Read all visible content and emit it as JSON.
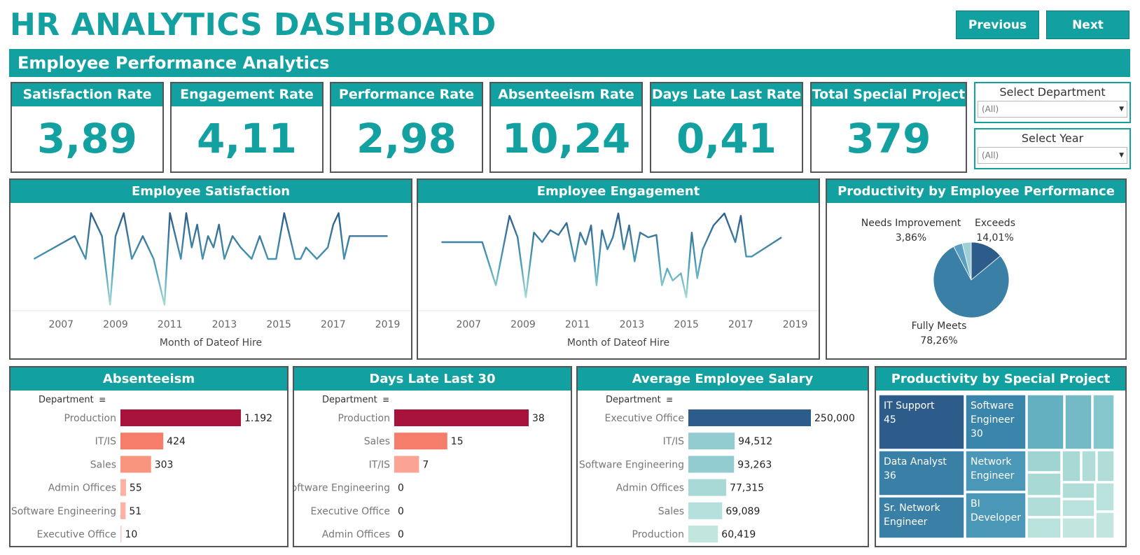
{
  "header": {
    "title": "HR ANALYTICS DASHBOARD",
    "previous_label": "Previous",
    "next_label": "Next",
    "banner": "Employee Performance Analytics"
  },
  "kpis": [
    {
      "label": "Satisfaction Rate",
      "value": "3,89"
    },
    {
      "label": "Engagement Rate",
      "value": "4,11"
    },
    {
      "label": "Performance Rate",
      "value": "2,98"
    },
    {
      "label": "Absenteeism Rate",
      "value": "10,24"
    },
    {
      "label": "Days Late Last Rate",
      "value": "0,41"
    },
    {
      "label": "Total Special Project",
      "value": "379"
    }
  ],
  "filters": [
    {
      "label": "Select Department",
      "value": "(All)"
    },
    {
      "label": "Select Year",
      "value": "(All)"
    }
  ],
  "colors": {
    "teal": "#13a0a0",
    "maroon": "#a8133b",
    "salmon": "#f67d69",
    "light_salmon": "#fbb1a4",
    "navy_blue": "#2e5c8a",
    "light_teal": "#9fd4d2"
  },
  "chart_data": [
    {
      "id": "satisfaction",
      "type": "line",
      "title": "Employee Satisfaction",
      "xlabel": "Month of Dateof Hire",
      "ylabel": "",
      "xlim": [
        2005.5,
        2019.5
      ],
      "ylim": [
        0.8,
        5.2
      ],
      "x_ticks": [
        "2007",
        "2009",
        "2011",
        "2013",
        "2015",
        "2017",
        "2019"
      ],
      "x": [
        2006.0,
        2007.5,
        2007.9,
        2008.1,
        2008.5,
        2008.8,
        2009.0,
        2009.3,
        2009.6,
        2010.0,
        2010.4,
        2010.8,
        2011.0,
        2011.2,
        2011.4,
        2011.6,
        2011.8,
        2012.0,
        2012.2,
        2012.4,
        2012.6,
        2012.8,
        2013.0,
        2013.3,
        2013.6,
        2014.0,
        2014.3,
        2014.6,
        2014.9,
        2015.2,
        2015.4,
        2015.6,
        2015.8,
        2016.0,
        2016.4,
        2016.8,
        2017.0,
        2017.2,
        2017.4,
        2017.6,
        2018.5,
        2019.0
      ],
      "y": [
        3.0,
        4.0,
        3.0,
        5.0,
        4.0,
        1.0,
        4.0,
        5.0,
        3.0,
        4.0,
        3.0,
        1.0,
        5.0,
        4.0,
        3.0,
        5.0,
        3.5,
        4.5,
        3.0,
        4.0,
        3.5,
        4.5,
        3.0,
        4.0,
        3.5,
        3.0,
        4.0,
        3.0,
        3.0,
        5.0,
        4.0,
        3.0,
        3.0,
        3.5,
        3.0,
        3.5,
        4.5,
        5.0,
        3.0,
        4.0,
        4.0,
        4.0
      ]
    },
    {
      "id": "engagement",
      "type": "line",
      "title": "Employee Engagement",
      "xlabel": "Month of Dateof Hire",
      "ylabel": "",
      "xlim": [
        2005.5,
        2019.5
      ],
      "ylim": [
        1.0,
        5.2
      ],
      "x_ticks": [
        "2007",
        "2009",
        "2011",
        "2013",
        "2015",
        "2017",
        "2019"
      ],
      "x": [
        2006.0,
        2007.5,
        2008.0,
        2008.5,
        2008.8,
        2009.1,
        2009.4,
        2009.7,
        2010.0,
        2010.3,
        2010.6,
        2010.9,
        2011.1,
        2011.3,
        2011.5,
        2011.7,
        2011.9,
        2012.1,
        2012.3,
        2012.5,
        2012.7,
        2012.9,
        2013.1,
        2013.3,
        2013.6,
        2013.9,
        2014.1,
        2014.3,
        2014.5,
        2014.8,
        2015.0,
        2015.2,
        2015.4,
        2015.6,
        2016.0,
        2016.4,
        2016.8,
        2017.0,
        2017.2,
        2017.4,
        2018.5
      ],
      "y": [
        3.8,
        3.8,
        2.0,
        4.9,
        4.0,
        1.5,
        4.2,
        3.8,
        4.3,
        4.1,
        4.6,
        3.0,
        4.2,
        3.7,
        4.5,
        2.0,
        4.3,
        3.5,
        4.0,
        5.0,
        3.5,
        4.5,
        3.0,
        4.2,
        4.0,
        4.1,
        2.0,
        2.7,
        2.2,
        2.5,
        1.5,
        4.2,
        2.3,
        3.5,
        4.5,
        5.0,
        3.8,
        4.9,
        3.2,
        3.2,
        4.0
      ]
    },
    {
      "id": "productivity_performance",
      "type": "pie",
      "title": "Productivity by Employee Performance",
      "slices": [
        {
          "label": "Exceeds",
          "pct": "14,01%",
          "value": 14.01,
          "color": "#2e5c8a"
        },
        {
          "label": "Fully Meets",
          "pct": "78,26%",
          "value": 78.26,
          "color": "#3a7fa6"
        },
        {
          "label": "Needs Improvement",
          "pct": "3,86%",
          "value": 3.86,
          "color": "#5a9fbf"
        },
        {
          "label": "",
          "pct": "",
          "value": 3.87,
          "color": "#9fd0d6"
        }
      ]
    },
    {
      "id": "absenteeism",
      "type": "bar",
      "title": "Absenteeism",
      "ylabel": "Department",
      "xlim": [
        0,
        1192
      ],
      "categories": [
        "Production",
        "IT/IS",
        "Sales",
        "Admin Offices",
        "Software Engineering",
        "Executive Office"
      ],
      "values": [
        1192,
        424,
        303,
        55,
        51,
        10
      ],
      "value_labels": [
        "1.192",
        "424",
        "303",
        "55",
        "51",
        "10"
      ],
      "colors": [
        "#a8133b",
        "#f67d69",
        "#f9957f",
        "#fbb1a4",
        "#fbb1a4",
        "#fcc7bd"
      ]
    },
    {
      "id": "days_late",
      "type": "bar",
      "title": "Days Late Last 30",
      "ylabel": "Department",
      "xlim": [
        0,
        38
      ],
      "categories": [
        "Production",
        "Sales",
        "IT/IS",
        "Software Engineering",
        "Executive Office",
        "Admin Offices"
      ],
      "values": [
        38,
        15,
        7,
        0,
        0,
        0
      ],
      "value_labels": [
        "38",
        "15",
        "7",
        "0",
        "0",
        "0"
      ],
      "colors": [
        "#a8133b",
        "#f67d69",
        "#fba493",
        "#fcc7bd",
        "#fcc7bd",
        "#fcc7bd"
      ]
    },
    {
      "id": "avg_salary",
      "type": "bar",
      "title": "Average Employee Salary",
      "ylabel": "Department",
      "xlim": [
        0,
        250000
      ],
      "categories": [
        "Executive Office",
        "IT/IS",
        "Software Engineering",
        "Admin Offices",
        "Sales",
        "Production"
      ],
      "values": [
        250000,
        94512,
        93263,
        77315,
        69089,
        60419
      ],
      "value_labels": [
        "250,000",
        "94,512",
        "93,263",
        "77,315",
        "69,089",
        "60,419"
      ],
      "colors": [
        "#2e5c8a",
        "#93ccd0",
        "#93ccd0",
        "#a9d9d6",
        "#b6e0db",
        "#c2e6dd"
      ]
    },
    {
      "id": "special_project",
      "type": "treemap",
      "title": "Productivity by Special Project",
      "cells": [
        {
          "name": "IT Support",
          "value": "45",
          "color": "#2e5c8a"
        },
        {
          "name": "Data Analyst",
          "value": "36",
          "color": "#3a7fa6"
        },
        {
          "name": "Sr. Network Engineer",
          "value": "",
          "color": "#3a7fa6"
        },
        {
          "name": "Software Engineer",
          "value": "30",
          "color": "#3a85ab"
        },
        {
          "name": "Network Engineer",
          "value": "",
          "color": "#4a97b8"
        },
        {
          "name": "BI Developer",
          "value": "",
          "color": "#4a97b8"
        }
      ]
    }
  ]
}
